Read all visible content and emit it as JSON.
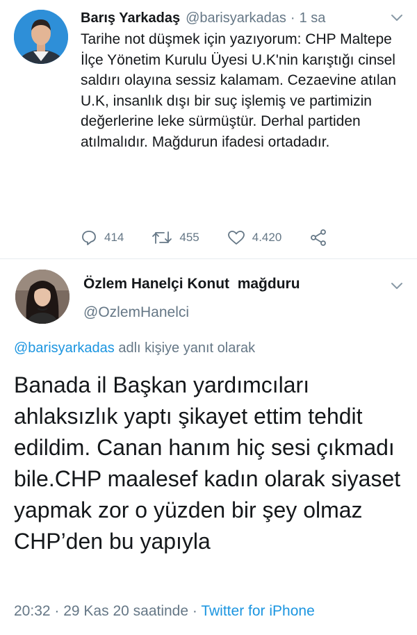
{
  "tweet1": {
    "author_name": "Barış Yarkadaş",
    "author_handle": "@barisyarkadas",
    "separator": "·",
    "time": "1 sa",
    "text": "Tarihe not düşmek için yazıyorum: CHP Maltepe İlçe Yönetim Kurulu Üyesi U.K'nin karıştığı cinsel saldırı olayına sessiz kalamam. Cezaevine atılan U.K, insanlık dışı bir suç işlemiş ve partimizin değerlerine leke sürmüştür. Derhal partiden atılmalıdır. Mağdurun ifadesi ortadadır.",
    "replies": "414",
    "retweets": "455",
    "likes": "4.420"
  },
  "tweet2": {
    "author_name": "Özlem Hanelçi Konut  mağduru",
    "author_handle": "@OzlemHanelci",
    "reply_to_handle": "@barisyarkadas",
    "reply_to_suffix": " adlı kişiye yanıt olarak",
    "text": "Banada il Başkan yardımcıları ahlaksızlık yaptı şikayet ettim tehdit edildim. Canan hanım hiç sesi çıkmadı bile.CHP maalesef kadın olarak siyaset yapmak zor o yüzden bir şey olmaz CHP’den bu yapıyla",
    "time": "20:32",
    "separator1": " · ",
    "date": "29 Kas 20 saatinde",
    "separator2": " · ",
    "client": "Twitter for iPhone"
  },
  "colors": {
    "link": "#1b95e0",
    "secondary_text": "#657786",
    "primary_text": "#14171a"
  },
  "icons": [
    "chevron-down-icon",
    "reply-icon",
    "retweet-icon",
    "like-icon",
    "share-icon"
  ]
}
